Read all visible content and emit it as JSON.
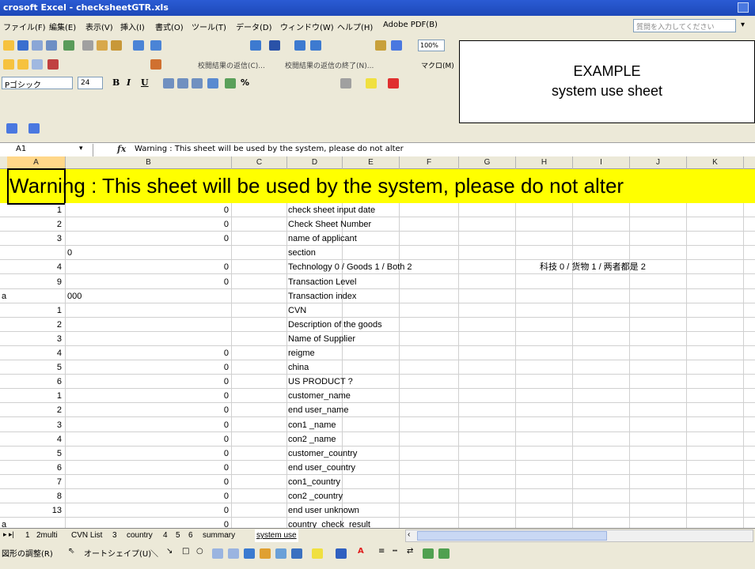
{
  "window": {
    "title": "crosoft Excel - checksheetGTR.xls"
  },
  "menu": {
    "items": [
      "ファイル(F)",
      "編集(E)",
      "表示(V)",
      "挿入(I)",
      "書式(O)",
      "ツール(T)",
      "データ(D)",
      "ウィンドウ(W)",
      "ヘルプ(H)",
      "Adobe PDF(B)"
    ],
    "help_placeholder": "質問を入力してください"
  },
  "toolbar": {
    "zoom": "100%",
    "font_name": "Pゴシック",
    "font_size": "24",
    "bold": "B",
    "italic": "I",
    "underline": "U",
    "percent": "%",
    "review_text_1": "校閲結果の返信(C)...",
    "review_text_2": "校閲結果の返信の終了(N)...",
    "macro": "マクロ(M)"
  },
  "overlay": {
    "line1": "EXAMPLE",
    "line2": "system use sheet"
  },
  "formula_bar": {
    "cell_ref": "A1",
    "fx": "fx",
    "content": "Warning : This sheet will be used by the system, please do not alter"
  },
  "columns": [
    "A",
    "B",
    "C",
    "D",
    "E",
    "F",
    "G",
    "H",
    "I",
    "J",
    "K"
  ],
  "warning_text": "Warning : This sheet will be used by the system, please do not alter",
  "rows": [
    {
      "a": "1",
      "b": "0",
      "d": "check sheet input date",
      "h": ""
    },
    {
      "a": "2",
      "b": "0",
      "d": "Check Sheet Number",
      "h": ""
    },
    {
      "a": "3",
      "b": "0",
      "d": "name of applicant",
      "h": ""
    },
    {
      "a": "",
      "b": "0",
      "d": "section",
      "h": ""
    },
    {
      "a": "4",
      "b": "0",
      "d": "Technology 0 / Goods 1 / Both 2",
      "h": "科技 0 / 货物 1 / 两者都是 2"
    },
    {
      "a": "9",
      "b": "0",
      "d": "Transaction Level",
      "h": ""
    },
    {
      "a": "a",
      "b": "000",
      "d": "Transaction index",
      "h": ""
    },
    {
      "a": "1",
      "b": "",
      "d": "CVN",
      "h": ""
    },
    {
      "a": "2",
      "b": "",
      "d": "Description of the goods",
      "h": ""
    },
    {
      "a": "3",
      "b": "",
      "d": "Name of Supplier",
      "h": ""
    },
    {
      "a": "4",
      "b": "0",
      "d": "reigme",
      "h": ""
    },
    {
      "a": "5",
      "b": "0",
      "d": "china",
      "h": ""
    },
    {
      "a": "6",
      "b": "0",
      "d": "US PRODUCT ?",
      "h": ""
    },
    {
      "a": "1",
      "b": "0",
      "d": "customer_name",
      "h": ""
    },
    {
      "a": "2",
      "b": "0",
      "d": "end user_name",
      "h": ""
    },
    {
      "a": "3",
      "b": "0",
      "d": "con1 _name",
      "h": ""
    },
    {
      "a": "4",
      "b": "0",
      "d": "con2 _name",
      "h": ""
    },
    {
      "a": "5",
      "b": "0",
      "d": "customer_country",
      "h": ""
    },
    {
      "a": "6",
      "b": "0",
      "d": "end user_country",
      "h": ""
    },
    {
      "a": "7",
      "b": "0",
      "d": "con1_country",
      "h": ""
    },
    {
      "a": "8",
      "b": "0",
      "d": "con2 _country",
      "h": ""
    },
    {
      "a": "13",
      "b": "0",
      "d": "end user unknown",
      "h": ""
    },
    {
      "a": "a",
      "b": "0",
      "d": "country_check_result",
      "h": ""
    }
  ],
  "sheet_tabs": {
    "nav": "▸ ▸|",
    "tabs": [
      "1",
      "2multi",
      "CVN List",
      "3",
      "country",
      "4",
      "5",
      "6",
      "summary",
      "system use"
    ],
    "active": "system use"
  },
  "draw_toolbar": {
    "draw": "図形の調整(R)",
    "autoshape": "オートシェイプ(U)"
  }
}
